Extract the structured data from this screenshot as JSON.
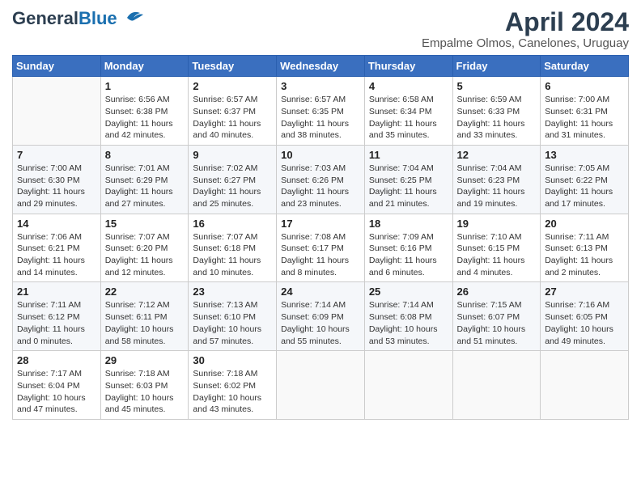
{
  "header": {
    "logo_general": "General",
    "logo_blue": "Blue",
    "month_title": "April 2024",
    "subtitle": "Empalme Olmos, Canelones, Uruguay"
  },
  "days_of_week": [
    "Sunday",
    "Monday",
    "Tuesday",
    "Wednesday",
    "Thursday",
    "Friday",
    "Saturday"
  ],
  "weeks": [
    [
      {
        "day": "",
        "info": ""
      },
      {
        "day": "1",
        "info": "Sunrise: 6:56 AM\nSunset: 6:38 PM\nDaylight: 11 hours\nand 42 minutes."
      },
      {
        "day": "2",
        "info": "Sunrise: 6:57 AM\nSunset: 6:37 PM\nDaylight: 11 hours\nand 40 minutes."
      },
      {
        "day": "3",
        "info": "Sunrise: 6:57 AM\nSunset: 6:35 PM\nDaylight: 11 hours\nand 38 minutes."
      },
      {
        "day": "4",
        "info": "Sunrise: 6:58 AM\nSunset: 6:34 PM\nDaylight: 11 hours\nand 35 minutes."
      },
      {
        "day": "5",
        "info": "Sunrise: 6:59 AM\nSunset: 6:33 PM\nDaylight: 11 hours\nand 33 minutes."
      },
      {
        "day": "6",
        "info": "Sunrise: 7:00 AM\nSunset: 6:31 PM\nDaylight: 11 hours\nand 31 minutes."
      }
    ],
    [
      {
        "day": "7",
        "info": "Sunrise: 7:00 AM\nSunset: 6:30 PM\nDaylight: 11 hours\nand 29 minutes."
      },
      {
        "day": "8",
        "info": "Sunrise: 7:01 AM\nSunset: 6:29 PM\nDaylight: 11 hours\nand 27 minutes."
      },
      {
        "day": "9",
        "info": "Sunrise: 7:02 AM\nSunset: 6:27 PM\nDaylight: 11 hours\nand 25 minutes."
      },
      {
        "day": "10",
        "info": "Sunrise: 7:03 AM\nSunset: 6:26 PM\nDaylight: 11 hours\nand 23 minutes."
      },
      {
        "day": "11",
        "info": "Sunrise: 7:04 AM\nSunset: 6:25 PM\nDaylight: 11 hours\nand 21 minutes."
      },
      {
        "day": "12",
        "info": "Sunrise: 7:04 AM\nSunset: 6:23 PM\nDaylight: 11 hours\nand 19 minutes."
      },
      {
        "day": "13",
        "info": "Sunrise: 7:05 AM\nSunset: 6:22 PM\nDaylight: 11 hours\nand 17 minutes."
      }
    ],
    [
      {
        "day": "14",
        "info": "Sunrise: 7:06 AM\nSunset: 6:21 PM\nDaylight: 11 hours\nand 14 minutes."
      },
      {
        "day": "15",
        "info": "Sunrise: 7:07 AM\nSunset: 6:20 PM\nDaylight: 11 hours\nand 12 minutes."
      },
      {
        "day": "16",
        "info": "Sunrise: 7:07 AM\nSunset: 6:18 PM\nDaylight: 11 hours\nand 10 minutes."
      },
      {
        "day": "17",
        "info": "Sunrise: 7:08 AM\nSunset: 6:17 PM\nDaylight: 11 hours\nand 8 minutes."
      },
      {
        "day": "18",
        "info": "Sunrise: 7:09 AM\nSunset: 6:16 PM\nDaylight: 11 hours\nand 6 minutes."
      },
      {
        "day": "19",
        "info": "Sunrise: 7:10 AM\nSunset: 6:15 PM\nDaylight: 11 hours\nand 4 minutes."
      },
      {
        "day": "20",
        "info": "Sunrise: 7:11 AM\nSunset: 6:13 PM\nDaylight: 11 hours\nand 2 minutes."
      }
    ],
    [
      {
        "day": "21",
        "info": "Sunrise: 7:11 AM\nSunset: 6:12 PM\nDaylight: 11 hours\nand 0 minutes."
      },
      {
        "day": "22",
        "info": "Sunrise: 7:12 AM\nSunset: 6:11 PM\nDaylight: 10 hours\nand 58 minutes."
      },
      {
        "day": "23",
        "info": "Sunrise: 7:13 AM\nSunset: 6:10 PM\nDaylight: 10 hours\nand 57 minutes."
      },
      {
        "day": "24",
        "info": "Sunrise: 7:14 AM\nSunset: 6:09 PM\nDaylight: 10 hours\nand 55 minutes."
      },
      {
        "day": "25",
        "info": "Sunrise: 7:14 AM\nSunset: 6:08 PM\nDaylight: 10 hours\nand 53 minutes."
      },
      {
        "day": "26",
        "info": "Sunrise: 7:15 AM\nSunset: 6:07 PM\nDaylight: 10 hours\nand 51 minutes."
      },
      {
        "day": "27",
        "info": "Sunrise: 7:16 AM\nSunset: 6:05 PM\nDaylight: 10 hours\nand 49 minutes."
      }
    ],
    [
      {
        "day": "28",
        "info": "Sunrise: 7:17 AM\nSunset: 6:04 PM\nDaylight: 10 hours\nand 47 minutes."
      },
      {
        "day": "29",
        "info": "Sunrise: 7:18 AM\nSunset: 6:03 PM\nDaylight: 10 hours\nand 45 minutes."
      },
      {
        "day": "30",
        "info": "Sunrise: 7:18 AM\nSunset: 6:02 PM\nDaylight: 10 hours\nand 43 minutes."
      },
      {
        "day": "",
        "info": ""
      },
      {
        "day": "",
        "info": ""
      },
      {
        "day": "",
        "info": ""
      },
      {
        "day": "",
        "info": ""
      }
    ]
  ]
}
